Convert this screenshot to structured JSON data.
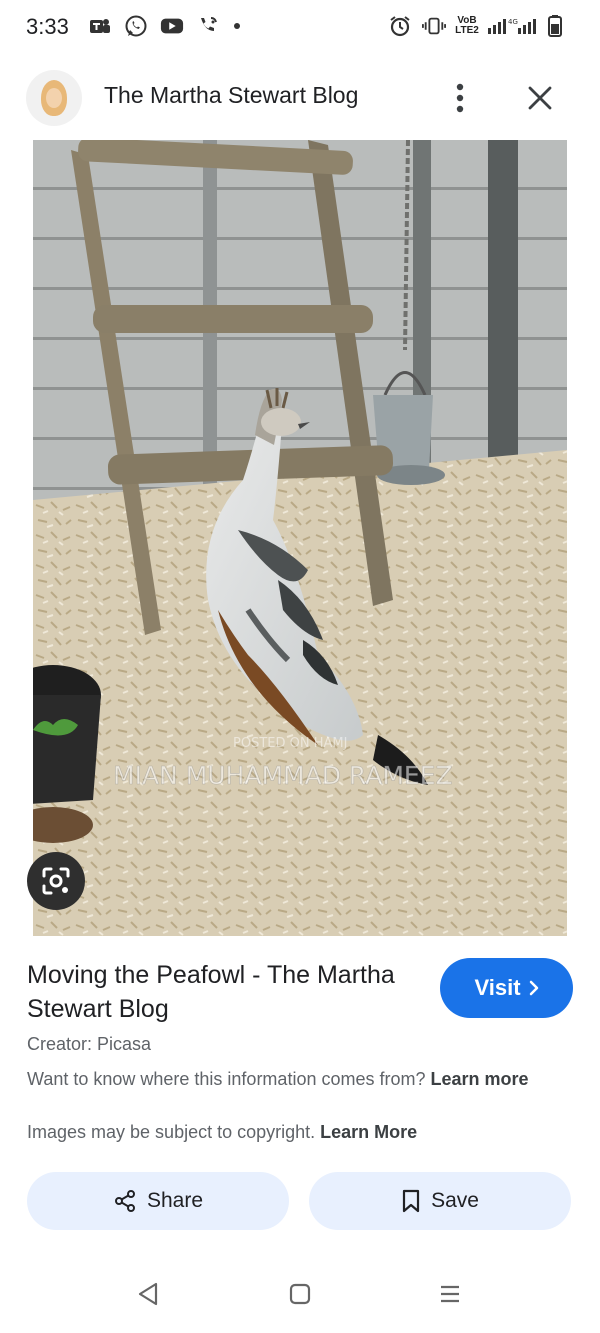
{
  "status_bar": {
    "time": "3:33",
    "left_icons": [
      "teams-icon",
      "whatsapp-icon",
      "youtube-icon",
      "wifi-calling-icon"
    ],
    "right_icons": [
      "alarm-icon",
      "vibrate-icon",
      "volte-icon",
      "signal-icon",
      "battery-icon"
    ],
    "network_text_top": "VoB",
    "network_text_bottom": "LTE2"
  },
  "header": {
    "site_title": "The Martha Stewart Blog",
    "avatar_icon": "site-avatar",
    "more_icon": "more-vert-icon",
    "close_icon": "close-icon"
  },
  "image": {
    "watermark_line1": "POSTED ON HAMJ",
    "watermark_line2": "MIAN MUHAMMAD RAMEEZ",
    "lens_icon": "lens-icon"
  },
  "result": {
    "title": "Moving the Peafowl - The Martha Stewart Blog",
    "visit_label": "Visit",
    "creator": "Creator: Picasa",
    "info_text": "Want to know where this information comes from?",
    "info_link": "Learn more",
    "copyright_text": "Images may be subject to copyright.",
    "copyright_link": "Learn More"
  },
  "actions": {
    "share_label": "Share",
    "save_label": "Save"
  },
  "nav_bar": {
    "back_icon": "back-icon",
    "home_icon": "home-icon",
    "recents_icon": "recents-icon"
  },
  "colors": {
    "accent": "#1a73e8",
    "pill_bg": "#e8f0fe",
    "text_secondary": "#5f6368"
  }
}
